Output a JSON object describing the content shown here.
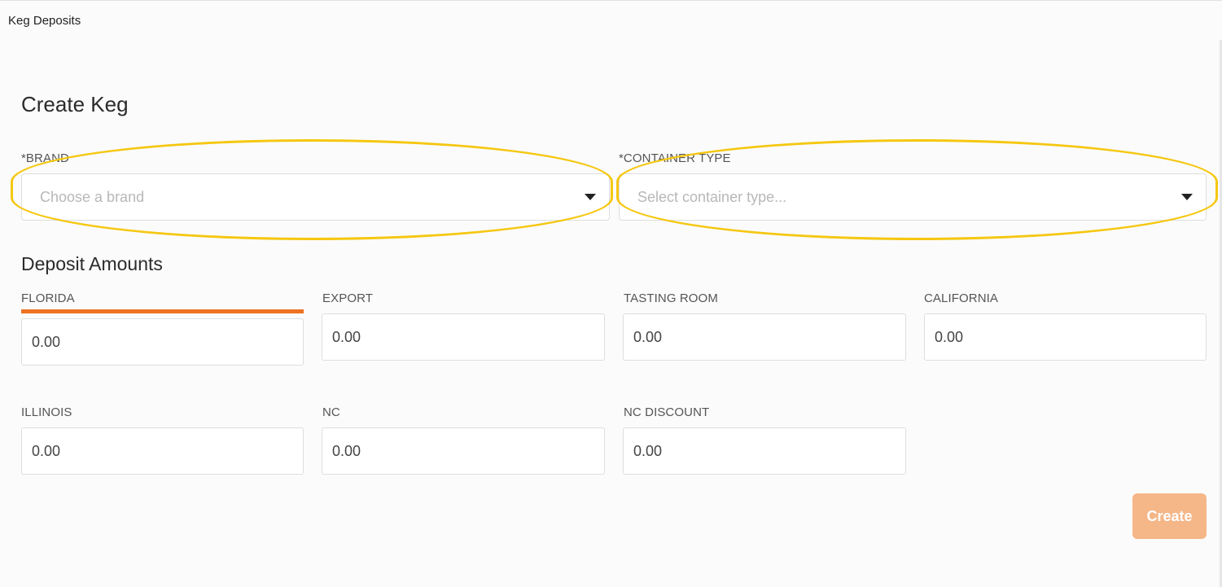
{
  "header": {
    "title": "Keg Deposits"
  },
  "form": {
    "title": "Create Keg",
    "brand": {
      "label": "*BRAND",
      "placeholder": "Choose a brand"
    },
    "container_type": {
      "label": "*CONTAINER TYPE",
      "placeholder": "Select container type..."
    }
  },
  "deposits": {
    "title": "Deposit Amounts",
    "fields": [
      {
        "label": "FLORIDA",
        "value": "0.00"
      },
      {
        "label": "EXPORT",
        "value": "0.00"
      },
      {
        "label": "TASTING ROOM",
        "value": "0.00"
      },
      {
        "label": "CALIFORNIA",
        "value": "0.00"
      },
      {
        "label": "ILLINOIS",
        "value": "0.00"
      },
      {
        "label": "NC",
        "value": "0.00"
      },
      {
        "label": "NC DISCOUNT",
        "value": "0.00"
      }
    ]
  },
  "actions": {
    "create_label": "Create"
  },
  "colors": {
    "accent": "#ee7222",
    "create_button": "#f5b688",
    "highlight": "#f5c710"
  },
  "icons": {
    "dropdown": "caret-down-icon"
  }
}
